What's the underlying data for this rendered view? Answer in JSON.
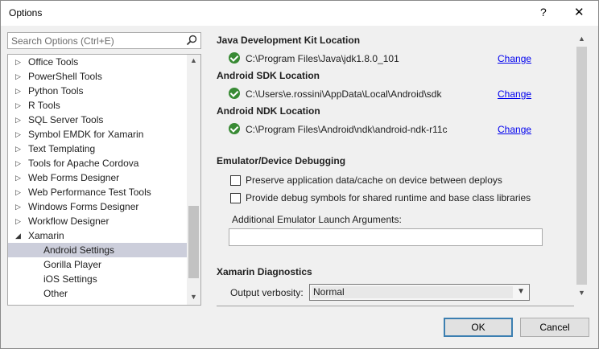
{
  "window": {
    "title": "Options",
    "help_glyph": "?",
    "close_glyph": "✕"
  },
  "search": {
    "placeholder": "Search Options (Ctrl+E)"
  },
  "tree": {
    "items": [
      {
        "label": "Office Tools",
        "expanded": false
      },
      {
        "label": "PowerShell Tools",
        "expanded": false
      },
      {
        "label": "Python Tools",
        "expanded": false
      },
      {
        "label": "R Tools",
        "expanded": false
      },
      {
        "label": "SQL Server Tools",
        "expanded": false
      },
      {
        "label": "Symbol EMDK for Xamarin",
        "expanded": false
      },
      {
        "label": "Text Templating",
        "expanded": false
      },
      {
        "label": "Tools for Apache Cordova",
        "expanded": false
      },
      {
        "label": "Web Forms Designer",
        "expanded": false
      },
      {
        "label": "Web Performance Test Tools",
        "expanded": false
      },
      {
        "label": "Windows Forms Designer",
        "expanded": false
      },
      {
        "label": "Workflow Designer",
        "expanded": false
      },
      {
        "label": "Xamarin",
        "expanded": true
      },
      {
        "label": "Android Settings",
        "child": true,
        "selected": true
      },
      {
        "label": "Gorilla Player",
        "child": true
      },
      {
        "label": "iOS Settings",
        "child": true
      },
      {
        "label": "Other",
        "child": true
      }
    ]
  },
  "sdk": {
    "jdk": {
      "title": "Java Development Kit Location",
      "path": "C:\\Program Files\\Java\\jdk1.8.0_101",
      "action": "Change"
    },
    "android_sdk": {
      "title": "Android SDK Location",
      "path": "C:\\Users\\e.rossini\\AppData\\Local\\Android\\sdk",
      "action": "Change"
    },
    "ndk": {
      "title": "Android NDK Location",
      "path": "C:\\Program Files\\Android\\ndk\\android-ndk-r11c",
      "action": "Change"
    }
  },
  "emulator": {
    "title": "Emulator/Device Debugging",
    "preserve_label": "Preserve application data/cache on device between deploys",
    "preserve_checked": false,
    "debug_symbols_label": "Provide debug symbols for shared runtime and base class libraries",
    "debug_symbols_checked": false,
    "args_label": "Additional Emulator Launch Arguments:",
    "args_value": ""
  },
  "diagnostics": {
    "title": "Xamarin Diagnostics",
    "verbosity_label": "Output verbosity:",
    "verbosity_value": "Normal"
  },
  "buttons": {
    "ok": "OK",
    "cancel": "Cancel"
  },
  "colors": {
    "check_green": "#388a34",
    "link_blue": "#0000ee",
    "selected_row": "#cccedb",
    "default_button_border": "#3c7fb1"
  }
}
